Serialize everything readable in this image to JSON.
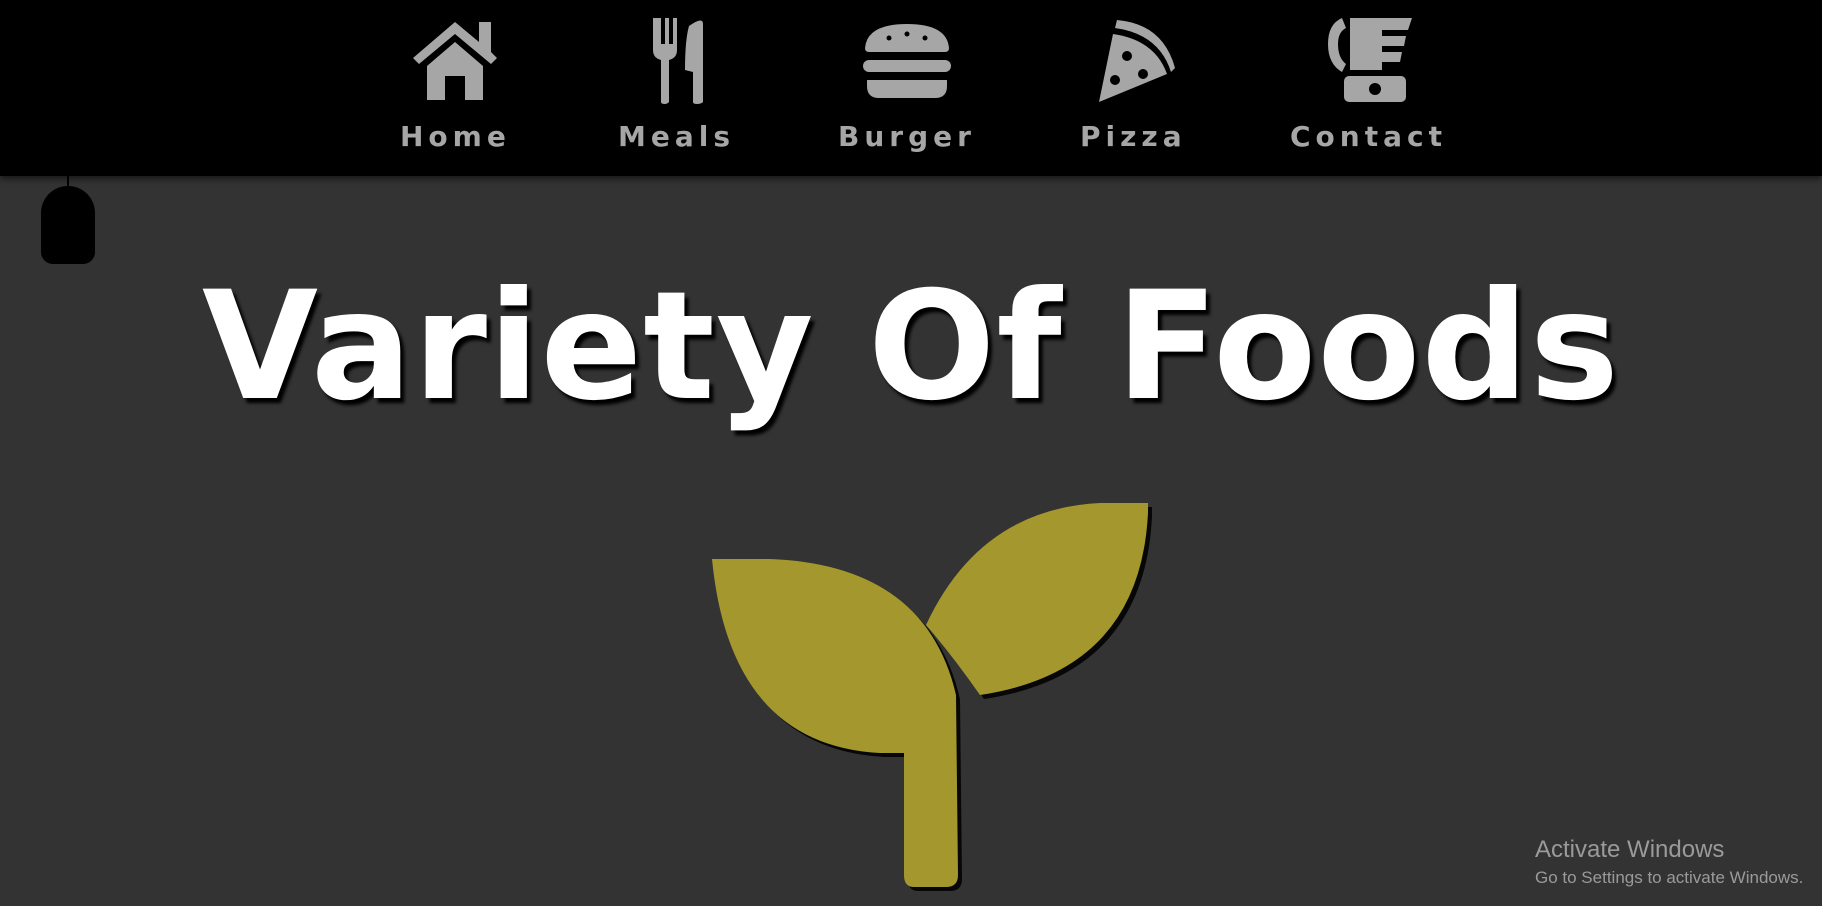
{
  "colors": {
    "background": "#333333",
    "navbar": "#000000",
    "nav_text": "#a6a6a6",
    "title": "#ffffff",
    "sprout": "#a3972e"
  },
  "nav": {
    "items": [
      {
        "label": "Home",
        "icon": "home-icon"
      },
      {
        "label": "Meals",
        "icon": "utensils-icon"
      },
      {
        "label": "Burger",
        "icon": "burger-icon"
      },
      {
        "label": "Pizza",
        "icon": "pizza-icon"
      },
      {
        "label": "Contact",
        "icon": "phone-icon"
      }
    ]
  },
  "hero": {
    "title": "Variety Of Foods",
    "logo_icon": "sprout-icon"
  },
  "scroll_indicator": {
    "icon": "mouse-icon"
  },
  "watermark": {
    "title": "Activate Windows",
    "subtitle": "Go to Settings to activate Windows."
  }
}
